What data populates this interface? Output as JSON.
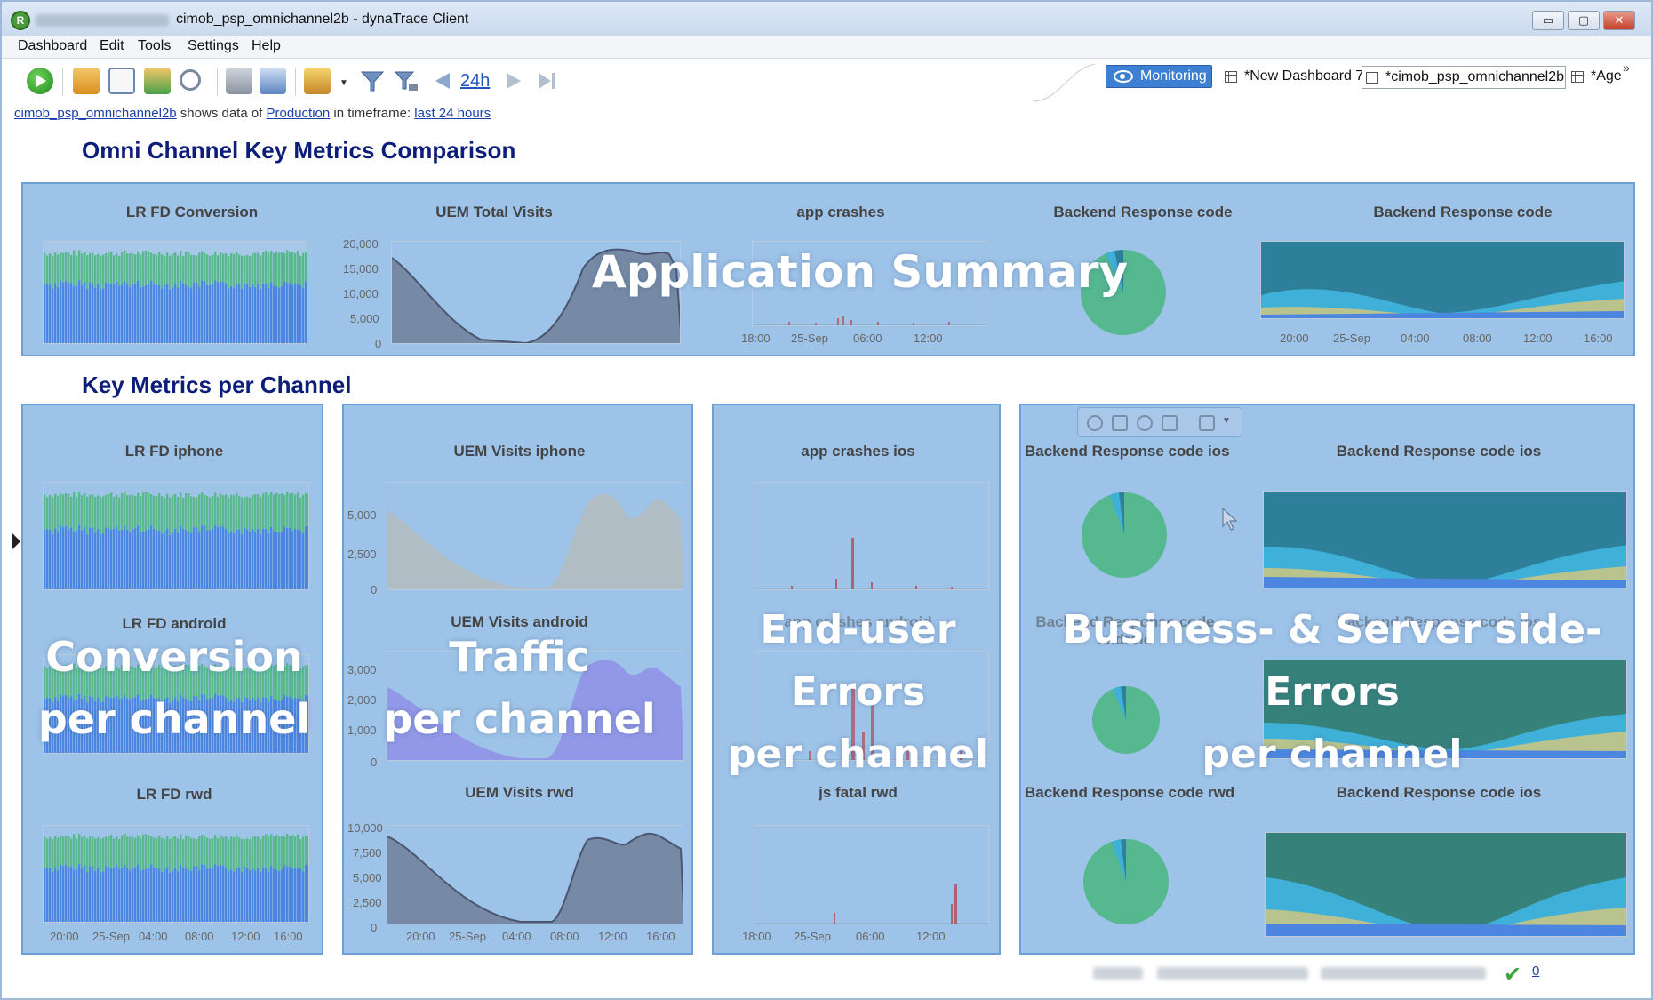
{
  "window": {
    "title": "cimob_psp_omnichannel2b - dynaTrace Client",
    "buttons": {
      "minimize": "▭",
      "maximize": "▢",
      "close": "✕"
    }
  },
  "menu": [
    "Dashboard",
    "Edit",
    "Tools",
    "Settings",
    "Help"
  ],
  "toolbar": {
    "timeframe_label": "24h"
  },
  "tabs": {
    "monitoring": "Monitoring",
    "tab1": "*New Dashboard 7",
    "tab2": "*cimob_psp_omnichannel2b",
    "tab3": "*Age",
    "more": "»"
  },
  "infoline": {
    "dashboard_link": "cimob_psp_omnichannel2b",
    "text1": "shows data of",
    "source_link": "Production",
    "text2": "in timeframe:",
    "timeframe_link": "last 24 hours"
  },
  "sections": {
    "summary_title": "Omni Channel Key Metrics Comparison",
    "channel_title": "Key Metrics per Channel"
  },
  "charts": {
    "c1": "LR FD Conversion",
    "c2": "UEM Total Visits",
    "c3": "app crashes",
    "c4": "Backend Response code",
    "c5": "Backend Response code",
    "lr_iphone": "LR FD iphone",
    "lr_android": "LR FD android",
    "lr_rwd": "LR FD rwd",
    "uem_iphone": "UEM Visits iphone",
    "uem_android": "UEM Visits android",
    "uem_rwd": "UEM Visits rwd",
    "crash_ios": "app crashes ios",
    "crash_android": "app crashes android",
    "js_rwd": "js fatal rwd",
    "be_ios_pie": "Backend Response code ios",
    "be_ios_bar": "Backend Response code ios",
    "be_android_pie": "Backend Response code android",
    "be_android_bar": "Backend Response code ios",
    "be_rwd_pie": "Backend Response code rwd",
    "be_rwd_bar": "Backend Response code ios"
  },
  "axes": {
    "total_visits_y": [
      "20,000",
      "15,000",
      "10,000",
      "5,000",
      "0"
    ],
    "iphone_y": [
      "5,000",
      "2,500",
      "0"
    ],
    "android_y": [
      "3,000",
      "2,000",
      "1,000",
      "0"
    ],
    "rwd_y": [
      "10,000",
      "7,500",
      "5,000",
      "2,500",
      "0"
    ],
    "time_x_a": [
      "18:00",
      "25-Sep",
      "06:00",
      "12:00"
    ],
    "time_x_b": [
      "20:00",
      "25-Sep",
      "04:00",
      "08:00",
      "12:00",
      "16:00"
    ]
  },
  "overlays": {
    "app_summary": "Application Summary",
    "conversion": [
      "Conversion",
      "per channel"
    ],
    "traffic": [
      "Traffic",
      "per channel"
    ],
    "enduser": [
      "End-user",
      "Errors",
      "per channel"
    ],
    "business": [
      "Business- & Server side-",
      "Errors",
      "per channel"
    ]
  },
  "status": {
    "count": "0"
  },
  "colors": {
    "panel": "#9ec3e8",
    "bar_blue": "#4d86e0",
    "bar_green": "#59b88e",
    "area_gray": "#6f7f97",
    "area_purple": "#8f90e6",
    "crash_red": "#b04a5a",
    "teal_dark": "#2d7f9a",
    "teal_light": "#3fb0d8",
    "pie_green": "#55b88f"
  }
}
